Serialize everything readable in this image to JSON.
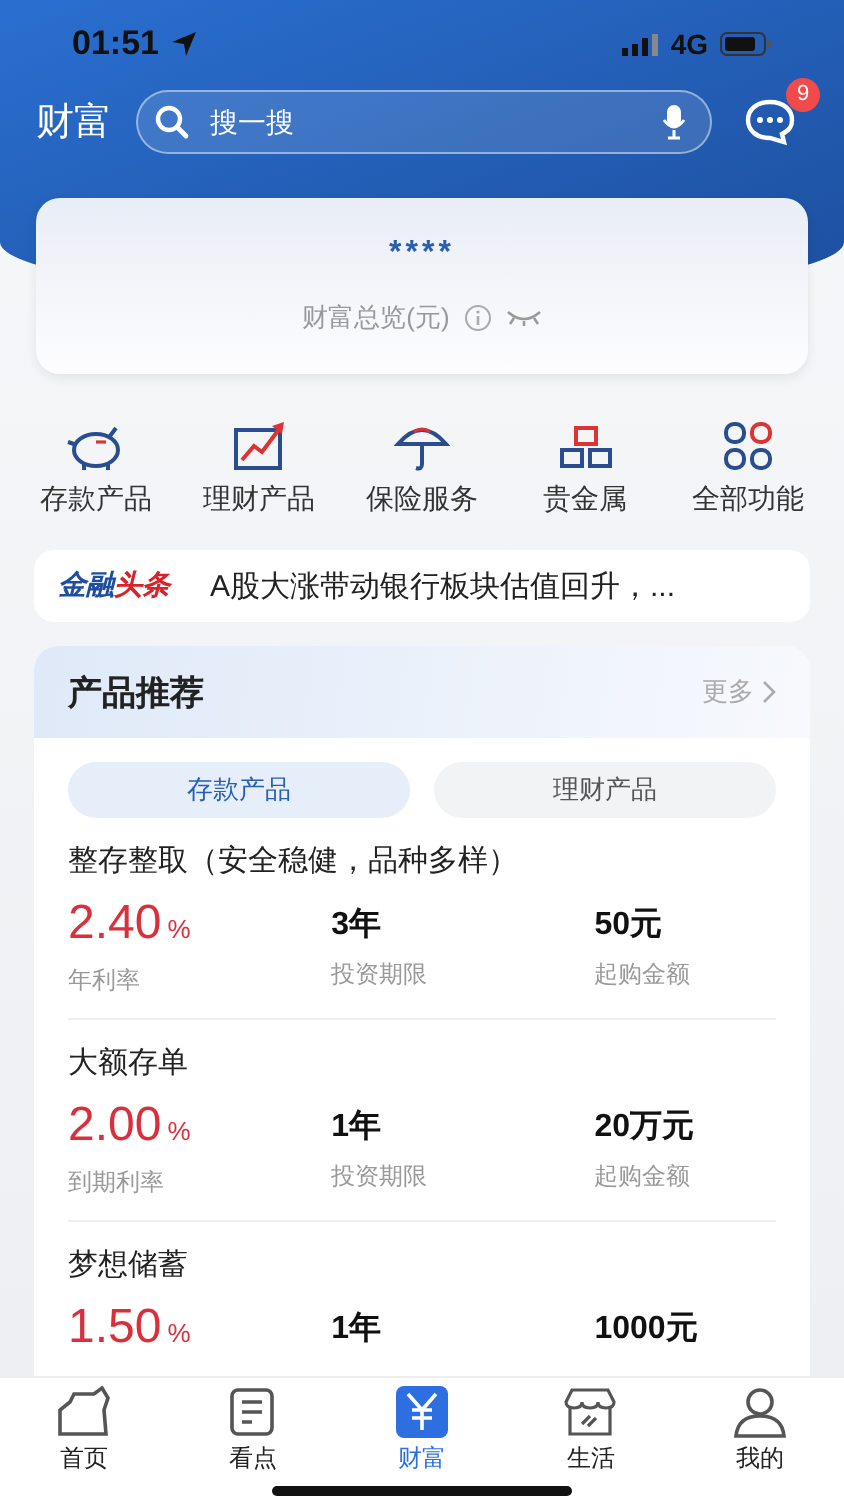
{
  "status_bar": {
    "time": "01:51",
    "network": "4G"
  },
  "header": {
    "title": "财富",
    "search": {
      "placeholder": "搜一搜"
    },
    "messages_badge": "9"
  },
  "overview": {
    "amount": "****",
    "label": "财富总览(元)"
  },
  "shortcuts": [
    {
      "label": "存款产品",
      "kind": "piggy"
    },
    {
      "label": "理财产品",
      "kind": "chart"
    },
    {
      "label": "保险服务",
      "kind": "umbrella"
    },
    {
      "label": "贵金属",
      "kind": "gold"
    },
    {
      "label": "全部功能",
      "kind": "grid"
    }
  ],
  "news": {
    "brand_main": "金融",
    "brand_accent": "头条",
    "headline": "A股大涨带动银行板块估值回升，..."
  },
  "products": {
    "title": "产品推荐",
    "more": "更多",
    "tabs": [
      {
        "label": "存款产品",
        "selected": true
      },
      {
        "label": "理财产品",
        "selected": false
      }
    ],
    "items": [
      {
        "name": "整存整取（安全稳健，品种多样）",
        "rate": "2.40",
        "rate_unit": "%",
        "rate_label": "年利率",
        "term": "3年",
        "term_label": "投资期限",
        "min": "50元",
        "min_label": "起购金额"
      },
      {
        "name": "大额存单",
        "rate": "2.00",
        "rate_unit": "%",
        "rate_label": "到期利率",
        "term": "1年",
        "term_label": "投资期限",
        "min": "20万元",
        "min_label": "起购金额"
      },
      {
        "name": "梦想储蓄",
        "rate": "1.50",
        "rate_unit": "%",
        "term": "1年",
        "min": "1000元"
      }
    ]
  },
  "tab_bar": [
    {
      "label": "首页",
      "kind": "home",
      "selected": false
    },
    {
      "label": "看点",
      "kind": "news",
      "selected": false
    },
    {
      "label": "财富",
      "kind": "wealth",
      "selected": true
    },
    {
      "label": "生活",
      "kind": "shop",
      "selected": false
    },
    {
      "label": "我的",
      "kind": "person",
      "selected": false
    }
  ]
}
